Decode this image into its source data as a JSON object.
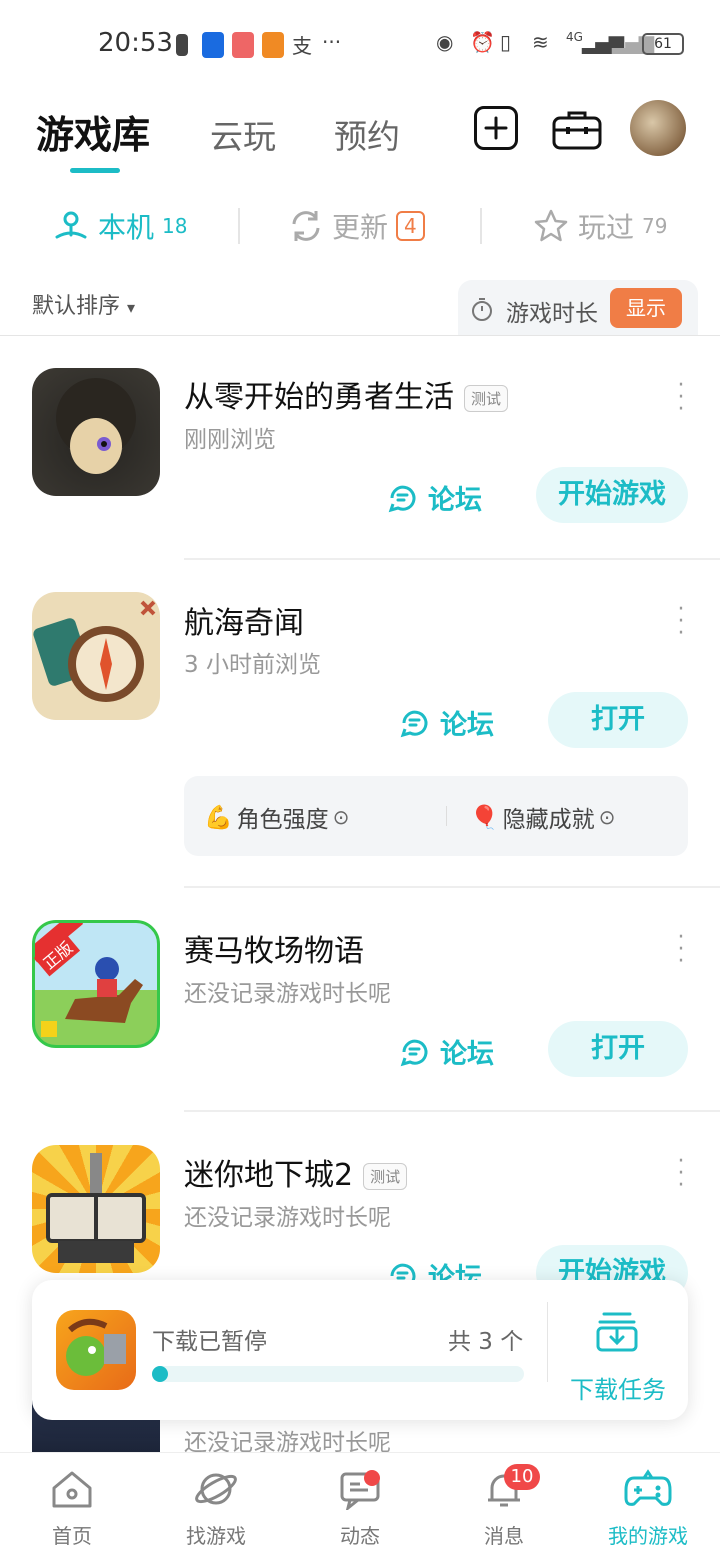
{
  "status_bar": {
    "time": "20:53",
    "network": "4G",
    "battery": "61",
    "more": "···"
  },
  "header": {
    "tabs": [
      {
        "label": "游戏库",
        "active": true
      },
      {
        "label": "云玩",
        "active": false
      },
      {
        "label": "预约",
        "active": false
      }
    ],
    "add_icon": "plus-square-icon",
    "toolbox_icon": "toolbox-icon"
  },
  "sub_tabs": [
    {
      "label": "本机",
      "count": "18",
      "icon": "local-device-icon",
      "active": true
    },
    {
      "label": "更新",
      "count": "4",
      "icon": "refresh-icon",
      "active": false
    },
    {
      "label": "玩过",
      "count": "79",
      "icon": "star-icon",
      "active": false
    }
  ],
  "sort": {
    "label": "默认排序",
    "arrow": "▾"
  },
  "playtime": {
    "label": "游戏时长",
    "button": "显示"
  },
  "games": [
    {
      "name": "从零开始的勇者生活",
      "tag": "测试",
      "sub": "刚刚浏览",
      "forum": "论坛",
      "action": "开始游戏"
    },
    {
      "name": "航海奇闻",
      "tag": "",
      "sub": "3 小时前浏览",
      "forum": "论坛",
      "action": "打开",
      "extras": [
        {
          "icon": "💪",
          "label": "角色强度"
        },
        {
          "icon": "🎈",
          "label": "隐藏成就"
        }
      ]
    },
    {
      "name": "赛马牧场物语",
      "tag": "",
      "sub": "还没记录游戏时长呢",
      "forum": "论坛",
      "action": "打开",
      "icon_badge": "正版"
    },
    {
      "name": "迷你地下城2",
      "tag": "测试",
      "sub": "还没记录游戏时长呢",
      "forum": "论坛",
      "action": "开始游戏"
    },
    {
      "name": "",
      "tag": "",
      "sub": "还没记录游戏时长呢"
    }
  ],
  "download": {
    "status": "下载已暂停",
    "count_text": "共 3 个",
    "progress": 0.02,
    "task_label": "下载任务"
  },
  "bottom_nav": [
    {
      "label": "首页",
      "icon": "home-icon",
      "active": false
    },
    {
      "label": "找游戏",
      "icon": "planet-icon",
      "active": false
    },
    {
      "label": "动态",
      "icon": "chat-icon",
      "active": false
    },
    {
      "label": "消息",
      "icon": "bell-icon",
      "active": false,
      "badge": "10"
    },
    {
      "label": "我的游戏",
      "icon": "gamepad-icon",
      "active": true
    }
  ],
  "colors": {
    "accent": "#1cbcc6",
    "orange": "#f07d46",
    "badge_red": "#f04848"
  }
}
